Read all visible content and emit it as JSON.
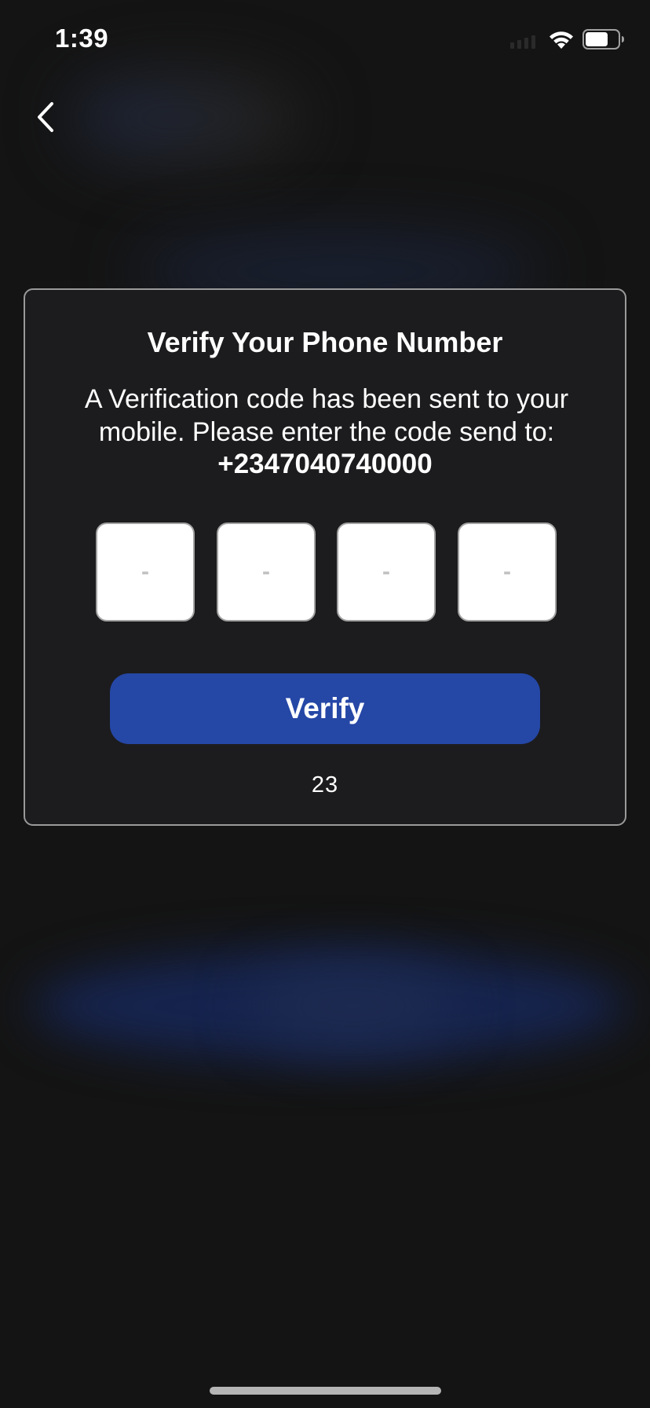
{
  "status_bar": {
    "time": "1:39",
    "icons": [
      "signal-icon",
      "wifi-icon",
      "battery-icon"
    ]
  },
  "nav": {
    "back_icon": "chevron-left-icon"
  },
  "verify_card": {
    "title": "Verify Your Phone Number",
    "description": "A Verification code has been sent to your mobile. Please enter the code send to:",
    "phone_number": "+2347040740000",
    "otp_placeholders": [
      "-",
      "-",
      "-",
      "-"
    ],
    "verify_label": "Verify",
    "countdown": "23"
  },
  "colors": {
    "background": "#141414",
    "card_background": "#1c1c1e",
    "card_border": "#9a9a9a",
    "accent": "#2547a6",
    "text": "#ffffff"
  }
}
